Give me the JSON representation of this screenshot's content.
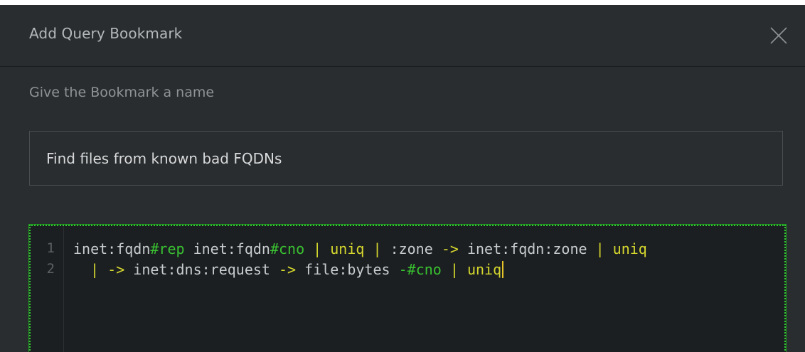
{
  "dialog": {
    "title": "Add Query Bookmark",
    "close_icon": "close-icon"
  },
  "name_field": {
    "label": "Give the Bookmark a name",
    "value": "Find files from known bad FQDNs"
  },
  "editor": {
    "line_numbers": [
      "1",
      "2"
    ],
    "lines": [
      [
        {
          "text": "inet:fqdn",
          "kind": "plain"
        },
        {
          "text": "#rep",
          "kind": "tag"
        },
        {
          "text": " inet:fqdn",
          "kind": "plain"
        },
        {
          "text": "#cno",
          "kind": "tag"
        },
        {
          "text": " | ",
          "kind": "op"
        },
        {
          "text": "uniq",
          "kind": "kw"
        },
        {
          "text": " | ",
          "kind": "op"
        },
        {
          "text": ":zone ",
          "kind": "plain"
        },
        {
          "text": "->",
          "kind": "op"
        },
        {
          "text": " inet:fqdn:zone ",
          "kind": "plain"
        },
        {
          "text": "| ",
          "kind": "op"
        },
        {
          "text": "uniq",
          "kind": "kw"
        }
      ],
      [
        {
          "text": "  ",
          "kind": "plain"
        },
        {
          "text": "| ->",
          "kind": "op"
        },
        {
          "text": " inet:dns:request ",
          "kind": "plain"
        },
        {
          "text": "->",
          "kind": "op"
        },
        {
          "text": " file:bytes ",
          "kind": "plain"
        },
        {
          "text": "-#cno",
          "kind": "tag"
        },
        {
          "text": " | ",
          "kind": "op"
        },
        {
          "text": "uniq",
          "kind": "kw"
        }
      ]
    ],
    "colors": {
      "tag": "#39c131",
      "keyword": "#d6d82e",
      "plain": "#c9ccce",
      "focus_border": "#33c933"
    }
  }
}
